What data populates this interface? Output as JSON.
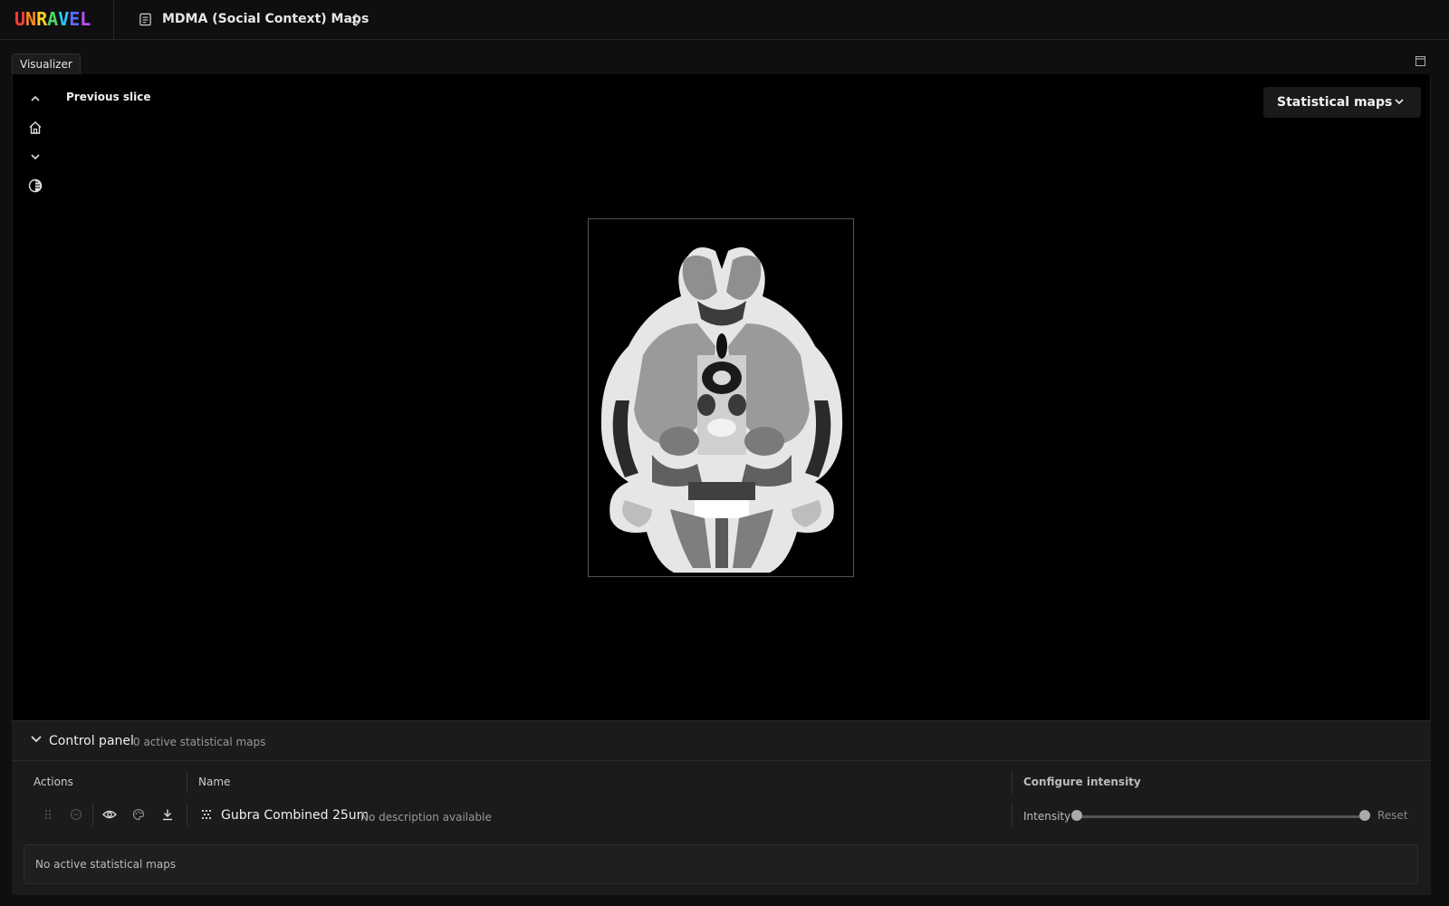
{
  "app": {
    "logo_letters": [
      "U",
      "N",
      "R",
      "A",
      "V",
      "E",
      "L"
    ],
    "logo_colors": [
      "#ff3b3b",
      "#ff8a1e",
      "#ffd21e",
      "#4cd964",
      "#2fc6ff",
      "#5b6cff",
      "#c14cff"
    ],
    "project_title": "MDMA (Social Context) Maps"
  },
  "tabs": [
    {
      "label": "Visualizer"
    }
  ],
  "viewer": {
    "tooltip": "Previous slice",
    "tools": [
      "chevron-up-icon",
      "home-icon",
      "chevron-down-icon",
      "contrast-icon"
    ],
    "stat_dropdown_label": "Statistical maps"
  },
  "control_panel": {
    "title": "Control panel",
    "subtitle": "0 active statistical maps",
    "columns": {
      "actions": "Actions",
      "name": "Name",
      "intensity": "Configure intensity"
    },
    "row": {
      "name": "Gubra Combined 25um",
      "description": "No description available",
      "intensity_label": "Intensity",
      "intensity_range": [
        0,
        1
      ],
      "reset_label": "Reset"
    },
    "empty_message": "No active statistical maps"
  },
  "colors": {
    "background": "#0f0f0f",
    "viewer": "#000000",
    "panel": "#1b1b1b"
  }
}
